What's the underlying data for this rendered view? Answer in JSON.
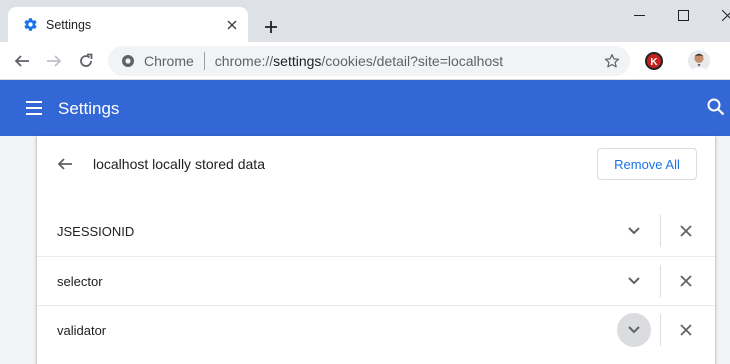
{
  "tab": {
    "title": "Settings"
  },
  "toolbar": {
    "chip_label": "Chrome",
    "url_scheme": "chrome://",
    "url_host": "settings",
    "url_path": "/cookies/detail?site=localhost"
  },
  "extension": {
    "letter": "K"
  },
  "header": {
    "title": "Settings"
  },
  "card": {
    "title": "localhost locally stored data",
    "remove_all_label": "Remove All"
  },
  "cookies": [
    {
      "name": "JSESSIONID"
    },
    {
      "name": "selector"
    },
    {
      "name": "validator"
    }
  ],
  "colors": {
    "header_blue": "#3367d6",
    "link_blue": "#1a73e8",
    "tab_strip": "#dee1e6",
    "extension_red": "#c5221f"
  }
}
